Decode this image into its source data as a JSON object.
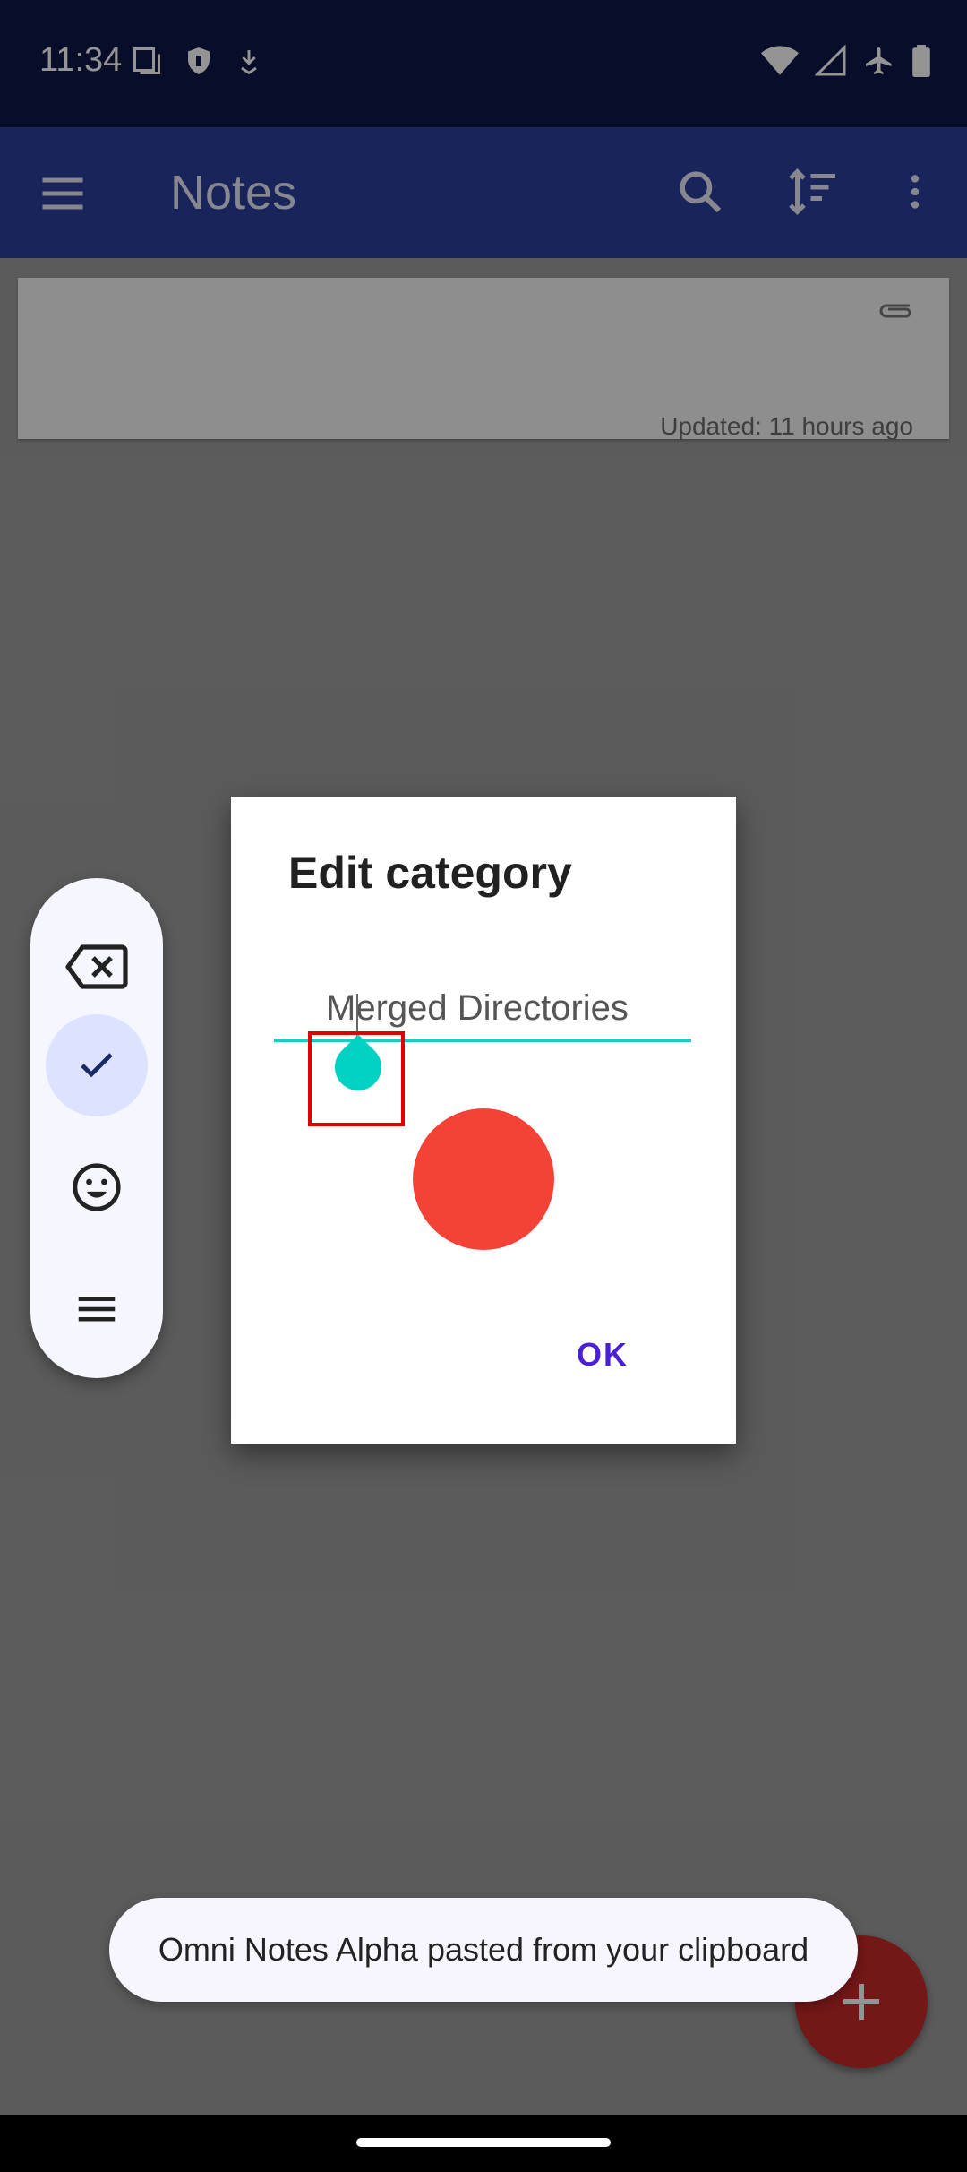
{
  "status_bar": {
    "time": "11:34",
    "left_icons": [
      "screenshot-icon",
      "shield-icon",
      "download-icon"
    ],
    "right_icons": [
      "wifi-icon",
      "signal-icon",
      "airplane-icon",
      "battery-icon"
    ]
  },
  "toolbar": {
    "title": "Notes",
    "icons": [
      "menu-icon",
      "search-icon",
      "sort-icon",
      "more-vert-icon"
    ]
  },
  "notes": [
    {
      "updated": "Updated: 11 hours ago",
      "has_attachment": true
    }
  ],
  "dialog": {
    "title": "Edit category",
    "input_value": "Merged Directories",
    "color": "#f44336",
    "ok_label": "OK"
  },
  "floating_toolbar": {
    "icons": [
      "backspace-icon",
      "check-icon",
      "emoji-icon",
      "menu-icon"
    ]
  },
  "snackbar": {
    "message": "Omni Notes Alpha pasted from your clipboard"
  },
  "fab": {
    "icon": "add-icon"
  }
}
